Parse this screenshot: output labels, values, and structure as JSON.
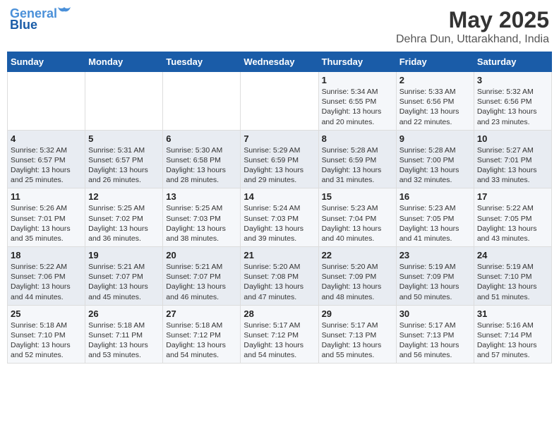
{
  "logo": {
    "line1": "General",
    "line2": "Blue"
  },
  "title": "May 2025",
  "subtitle": "Dehra Dun, Uttarakhand, India",
  "weekdays": [
    "Sunday",
    "Monday",
    "Tuesday",
    "Wednesday",
    "Thursday",
    "Friday",
    "Saturday"
  ],
  "weeks": [
    [
      {
        "day": "",
        "content": ""
      },
      {
        "day": "",
        "content": ""
      },
      {
        "day": "",
        "content": ""
      },
      {
        "day": "",
        "content": ""
      },
      {
        "day": "1",
        "content": "Sunrise: 5:34 AM\nSunset: 6:55 PM\nDaylight: 13 hours\nand 20 minutes."
      },
      {
        "day": "2",
        "content": "Sunrise: 5:33 AM\nSunset: 6:56 PM\nDaylight: 13 hours\nand 22 minutes."
      },
      {
        "day": "3",
        "content": "Sunrise: 5:32 AM\nSunset: 6:56 PM\nDaylight: 13 hours\nand 23 minutes."
      }
    ],
    [
      {
        "day": "4",
        "content": "Sunrise: 5:32 AM\nSunset: 6:57 PM\nDaylight: 13 hours\nand 25 minutes."
      },
      {
        "day": "5",
        "content": "Sunrise: 5:31 AM\nSunset: 6:57 PM\nDaylight: 13 hours\nand 26 minutes."
      },
      {
        "day": "6",
        "content": "Sunrise: 5:30 AM\nSunset: 6:58 PM\nDaylight: 13 hours\nand 28 minutes."
      },
      {
        "day": "7",
        "content": "Sunrise: 5:29 AM\nSunset: 6:59 PM\nDaylight: 13 hours\nand 29 minutes."
      },
      {
        "day": "8",
        "content": "Sunrise: 5:28 AM\nSunset: 6:59 PM\nDaylight: 13 hours\nand 31 minutes."
      },
      {
        "day": "9",
        "content": "Sunrise: 5:28 AM\nSunset: 7:00 PM\nDaylight: 13 hours\nand 32 minutes."
      },
      {
        "day": "10",
        "content": "Sunrise: 5:27 AM\nSunset: 7:01 PM\nDaylight: 13 hours\nand 33 minutes."
      }
    ],
    [
      {
        "day": "11",
        "content": "Sunrise: 5:26 AM\nSunset: 7:01 PM\nDaylight: 13 hours\nand 35 minutes."
      },
      {
        "day": "12",
        "content": "Sunrise: 5:25 AM\nSunset: 7:02 PM\nDaylight: 13 hours\nand 36 minutes."
      },
      {
        "day": "13",
        "content": "Sunrise: 5:25 AM\nSunset: 7:03 PM\nDaylight: 13 hours\nand 38 minutes."
      },
      {
        "day": "14",
        "content": "Sunrise: 5:24 AM\nSunset: 7:03 PM\nDaylight: 13 hours\nand 39 minutes."
      },
      {
        "day": "15",
        "content": "Sunrise: 5:23 AM\nSunset: 7:04 PM\nDaylight: 13 hours\nand 40 minutes."
      },
      {
        "day": "16",
        "content": "Sunrise: 5:23 AM\nSunset: 7:05 PM\nDaylight: 13 hours\nand 41 minutes."
      },
      {
        "day": "17",
        "content": "Sunrise: 5:22 AM\nSunset: 7:05 PM\nDaylight: 13 hours\nand 43 minutes."
      }
    ],
    [
      {
        "day": "18",
        "content": "Sunrise: 5:22 AM\nSunset: 7:06 PM\nDaylight: 13 hours\nand 44 minutes."
      },
      {
        "day": "19",
        "content": "Sunrise: 5:21 AM\nSunset: 7:07 PM\nDaylight: 13 hours\nand 45 minutes."
      },
      {
        "day": "20",
        "content": "Sunrise: 5:21 AM\nSunset: 7:07 PM\nDaylight: 13 hours\nand 46 minutes."
      },
      {
        "day": "21",
        "content": "Sunrise: 5:20 AM\nSunset: 7:08 PM\nDaylight: 13 hours\nand 47 minutes."
      },
      {
        "day": "22",
        "content": "Sunrise: 5:20 AM\nSunset: 7:09 PM\nDaylight: 13 hours\nand 48 minutes."
      },
      {
        "day": "23",
        "content": "Sunrise: 5:19 AM\nSunset: 7:09 PM\nDaylight: 13 hours\nand 50 minutes."
      },
      {
        "day": "24",
        "content": "Sunrise: 5:19 AM\nSunset: 7:10 PM\nDaylight: 13 hours\nand 51 minutes."
      }
    ],
    [
      {
        "day": "25",
        "content": "Sunrise: 5:18 AM\nSunset: 7:10 PM\nDaylight: 13 hours\nand 52 minutes."
      },
      {
        "day": "26",
        "content": "Sunrise: 5:18 AM\nSunset: 7:11 PM\nDaylight: 13 hours\nand 53 minutes."
      },
      {
        "day": "27",
        "content": "Sunrise: 5:18 AM\nSunset: 7:12 PM\nDaylight: 13 hours\nand 54 minutes."
      },
      {
        "day": "28",
        "content": "Sunrise: 5:17 AM\nSunset: 7:12 PM\nDaylight: 13 hours\nand 54 minutes."
      },
      {
        "day": "29",
        "content": "Sunrise: 5:17 AM\nSunset: 7:13 PM\nDaylight: 13 hours\nand 55 minutes."
      },
      {
        "day": "30",
        "content": "Sunrise: 5:17 AM\nSunset: 7:13 PM\nDaylight: 13 hours\nand 56 minutes."
      },
      {
        "day": "31",
        "content": "Sunrise: 5:16 AM\nSunset: 7:14 PM\nDaylight: 13 hours\nand 57 minutes."
      }
    ]
  ]
}
